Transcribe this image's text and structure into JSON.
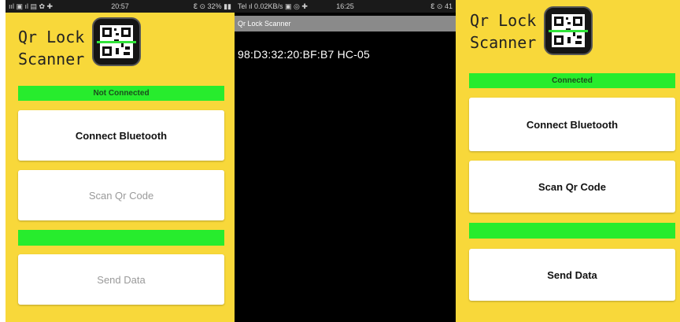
{
  "screen1": {
    "statusbar": {
      "left": "ııl ▣ ıl ▤ ✿ ✚",
      "time": "20:57",
      "right": "ℇ ⊙ 32% ▮▮"
    },
    "app_title": "Qr Lock\nScanner",
    "logo_icon": "qr-scanner-logo",
    "status_text": "Not Connected",
    "buttons": {
      "connect": "Connect Bluetooth",
      "scan": "Scan Qr Code",
      "send": "Send Data"
    }
  },
  "screen2": {
    "statusbar": {
      "left": "Tel ıl 0.02KB/s ▣ ◎ ✚",
      "time": "16:25",
      "right": "ℇ ⊙ 41"
    },
    "title": "Qr Lock Scanner",
    "device_item": "98:D3:32:20:BF:B7 HC-05"
  },
  "screen3": {
    "app_title": "Qr Lock\nScanner",
    "logo_icon": "qr-scanner-logo",
    "status_text": "Connected",
    "buttons": {
      "connect": "Connect Bluetooth",
      "scan": "Scan Qr Code",
      "send": "Send Data"
    }
  },
  "colors": {
    "app_background": "#f8d83a",
    "status_green": "#27ec2d",
    "list_background": "#000000"
  }
}
